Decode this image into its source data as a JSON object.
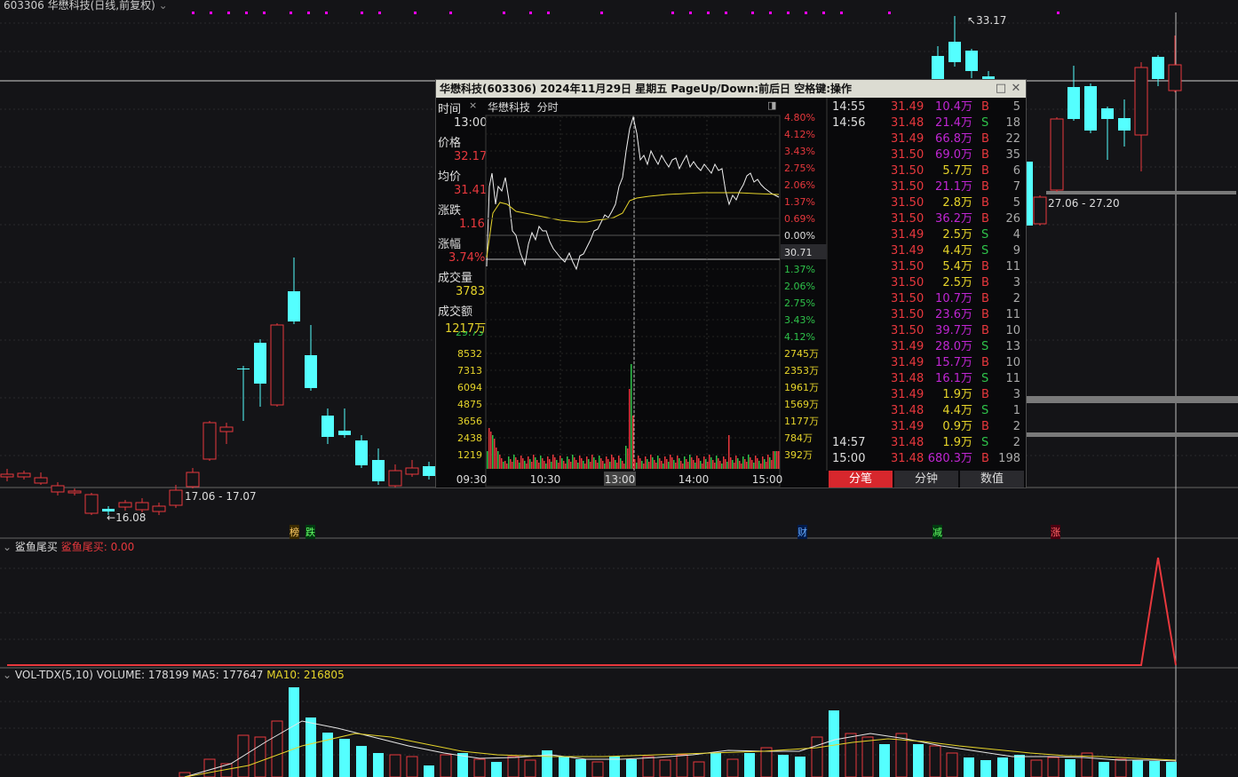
{
  "header": {
    "title": "603306 华懋科技(日线,前复权)"
  },
  "kline": {
    "high_label": "33.17",
    "low_label": "16.08",
    "range_label_1": "17.06 - 17.07",
    "range_label_2": "27.06 - 27.20",
    "tags": [
      "榜",
      "跌",
      "财",
      "减",
      "涨"
    ],
    "colors": {
      "up": "#e8383d",
      "down": "#54ffff",
      "bg": "#141417",
      "magenta": "#ff00ff"
    }
  },
  "indicator1": {
    "name": "鲨鱼尾买",
    "value_label": "鲨鱼尾买: 0.00"
  },
  "indicator2": {
    "name": "VOL-TDX(5,10)",
    "volume": "VOLUME: 178199",
    "ma5": "MA5: 177647",
    "ma10": "MA10: 216805"
  },
  "popup": {
    "title": "华懋科技(603306)  2024年11月29日  星期五  PageUp/Down:前后日  空格键:操作",
    "chart_title": "华懋科技",
    "chart_mode": "分时",
    "info": {
      "time_label": "时间",
      "time_value": "13:00",
      "price_label": "价格",
      "price_value": "32.17",
      "avg_label": "均价",
      "avg_value": "31.41",
      "change_label": "涨跌",
      "change_value": "1.16",
      "pct_label": "涨幅",
      "pct_value": "3.74%",
      "vol_label": "成交量",
      "vol_value": "3783",
      "amount_label": "成交额",
      "amount_value": "1217万"
    },
    "right_axis": [
      "4.80%",
      "4.12%",
      "3.43%",
      "2.75%",
      "2.06%",
      "1.37%",
      "0.69%",
      "0.00%",
      "30.71",
      "1.37%",
      "2.06%",
      "2.75%",
      "3.43%",
      "4.12%"
    ],
    "partial_left_label": "29.73",
    "vol_left_axis": [
      "8532",
      "7313",
      "6094",
      "4875",
      "3656",
      "2438",
      "1219"
    ],
    "vol_right_axis": [
      "2745万",
      "2353万",
      "1961万",
      "1569万",
      "1177万",
      "784万",
      "392万"
    ],
    "time_axis": [
      "09:30",
      "10:30",
      "13:00",
      "14:00",
      "15:00"
    ],
    "ticks": [
      {
        "time": "14:55",
        "price": "31.49",
        "vol": "10.4万",
        "side": "B",
        "n": "5"
      },
      {
        "time": "14:56",
        "price": "31.48",
        "vol": "21.4万",
        "side": "S",
        "n": "18"
      },
      {
        "time": "",
        "price": "31.49",
        "vol": "66.8万",
        "side": "B",
        "n": "22"
      },
      {
        "time": "",
        "price": "31.50",
        "vol": "69.0万",
        "side": "B",
        "n": "35"
      },
      {
        "time": "",
        "price": "31.50",
        "vol": "5.7万",
        "side": "B",
        "n": "6"
      },
      {
        "time": "",
        "price": "31.50",
        "vol": "21.1万",
        "side": "B",
        "n": "7"
      },
      {
        "time": "",
        "price": "31.50",
        "vol": "2.8万",
        "side": "B",
        "n": "5"
      },
      {
        "time": "",
        "price": "31.50",
        "vol": "36.2万",
        "side": "B",
        "n": "26"
      },
      {
        "time": "",
        "price": "31.49",
        "vol": "2.5万",
        "side": "S",
        "n": "4"
      },
      {
        "time": "",
        "price": "31.49",
        "vol": "4.4万",
        "side": "S",
        "n": "9"
      },
      {
        "time": "",
        "price": "31.50",
        "vol": "5.4万",
        "side": "B",
        "n": "11"
      },
      {
        "time": "",
        "price": "31.50",
        "vol": "2.5万",
        "side": "B",
        "n": "3"
      },
      {
        "time": "",
        "price": "31.50",
        "vol": "10.7万",
        "side": "B",
        "n": "2"
      },
      {
        "time": "",
        "price": "31.50",
        "vol": "23.6万",
        "side": "B",
        "n": "11"
      },
      {
        "time": "",
        "price": "31.50",
        "vol": "39.7万",
        "side": "B",
        "n": "10"
      },
      {
        "time": "",
        "price": "31.49",
        "vol": "28.0万",
        "side": "S",
        "n": "13"
      },
      {
        "time": "",
        "price": "31.49",
        "vol": "15.7万",
        "side": "B",
        "n": "10"
      },
      {
        "time": "",
        "price": "31.48",
        "vol": "16.1万",
        "side": "S",
        "n": "11"
      },
      {
        "time": "",
        "price": "31.49",
        "vol": "1.9万",
        "side": "B",
        "n": "3"
      },
      {
        "time": "",
        "price": "31.48",
        "vol": "4.4万",
        "side": "S",
        "n": "1"
      },
      {
        "time": "",
        "price": "31.49",
        "vol": "0.9万",
        "side": "B",
        "n": "2"
      },
      {
        "time": "14:57",
        "price": "31.48",
        "vol": "1.9万",
        "side": "S",
        "n": "2"
      },
      {
        "time": "15:00",
        "price": "31.48",
        "vol": "680.3万",
        "side": "B",
        "n": "198"
      }
    ],
    "tabs": [
      "分笔",
      "分钟",
      "数值"
    ]
  }
}
